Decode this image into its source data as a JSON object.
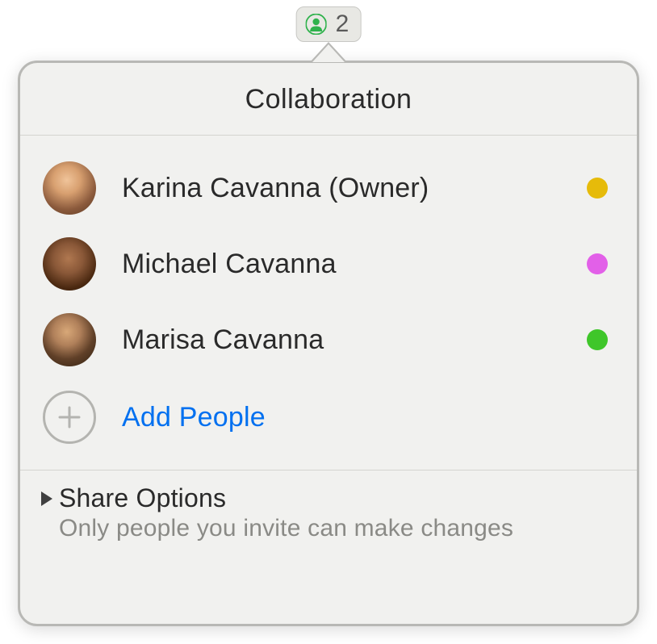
{
  "badge": {
    "count": "2"
  },
  "popover": {
    "title": "Collaboration",
    "participants": [
      {
        "name": "Karina Cavanna (Owner)",
        "color": "#e6bb0a"
      },
      {
        "name": "Michael Cavanna",
        "color": "#e260e8"
      },
      {
        "name": "Marisa Cavanna",
        "color": "#3fc62a"
      }
    ],
    "add_people_label": "Add People",
    "share_options": {
      "title": "Share Options",
      "subtitle": "Only people you invite can make changes"
    }
  }
}
